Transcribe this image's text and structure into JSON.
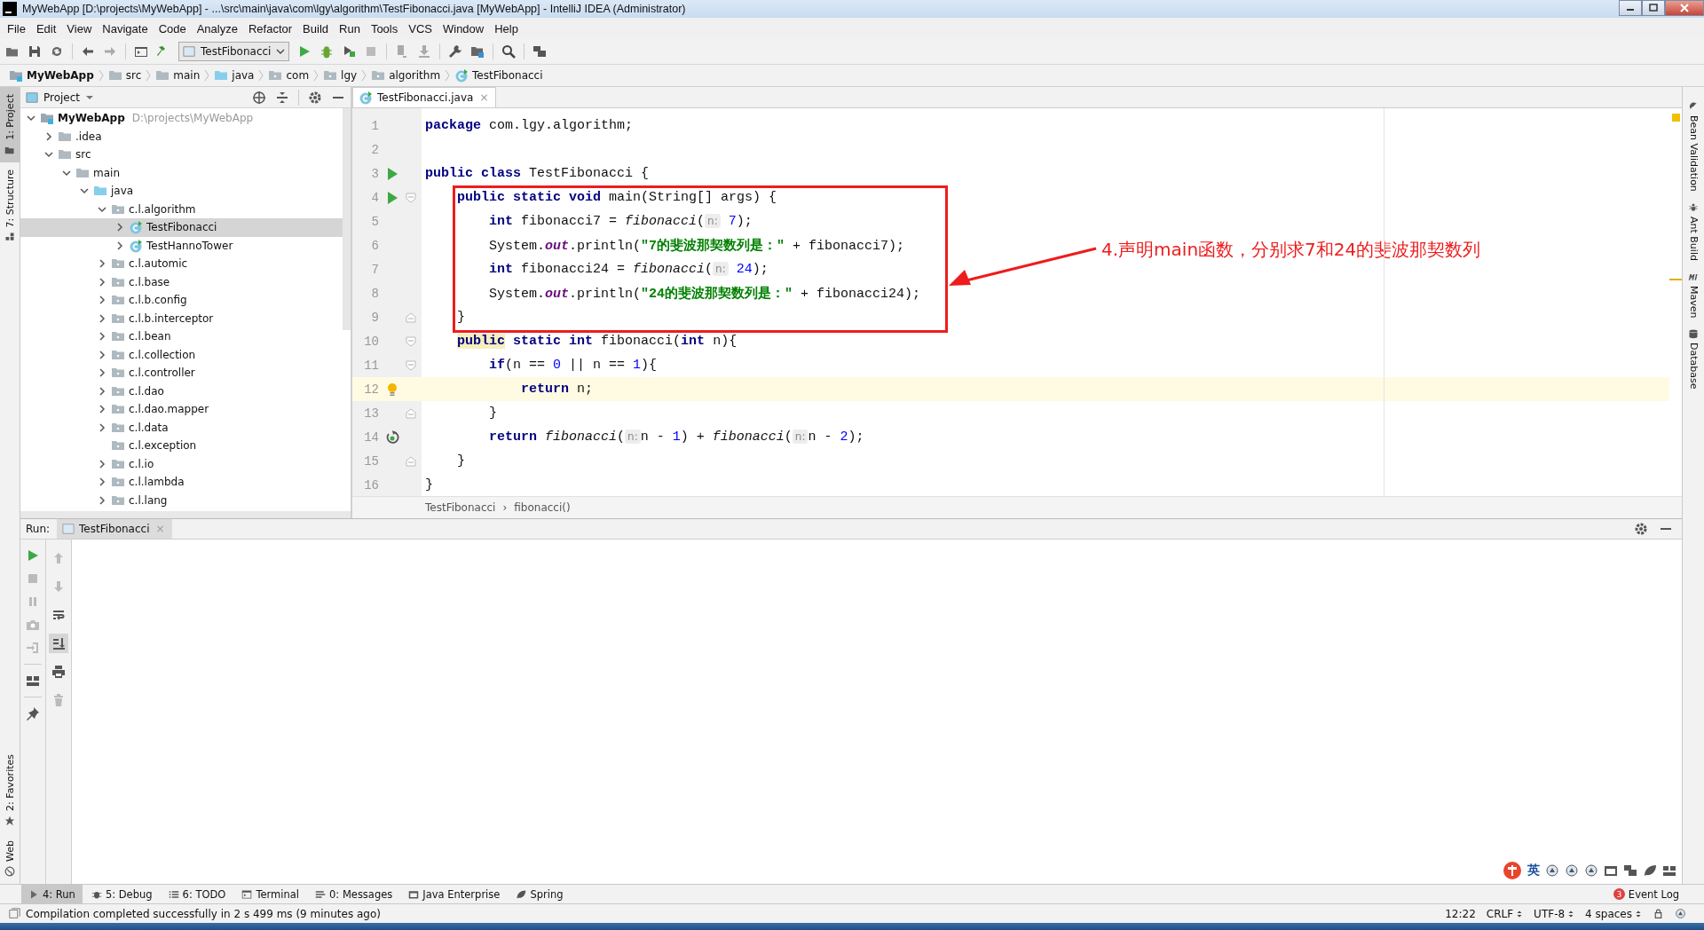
{
  "window": {
    "title": "MyWebApp [D:\\projects\\MyWebApp] - ...\\src\\main\\java\\com\\lgy\\algorithm\\TestFibonacci.java [MyWebApp] - IntelliJ IDEA (Administrator)"
  },
  "menu": [
    "File",
    "Edit",
    "View",
    "Navigate",
    "Code",
    "Analyze",
    "Refactor",
    "Build",
    "Run",
    "Tools",
    "VCS",
    "Window",
    "Help"
  ],
  "run_configuration": "TestFibonacci",
  "breadcrumbs": [
    {
      "label": "MyWebApp",
      "kind": "module"
    },
    {
      "label": "src",
      "kind": "folder"
    },
    {
      "label": "main",
      "kind": "folder"
    },
    {
      "label": "java",
      "kind": "source"
    },
    {
      "label": "com",
      "kind": "package"
    },
    {
      "label": "lgy",
      "kind": "package"
    },
    {
      "label": "algorithm",
      "kind": "package"
    },
    {
      "label": "TestFibonacci",
      "kind": "class"
    }
  ],
  "left_stripe": {
    "top": [
      {
        "label": "1: Project",
        "selected": true
      },
      {
        "label": "7: Structure",
        "selected": false
      }
    ],
    "bottom": [
      {
        "label": "2: Favorites",
        "selected": false
      },
      {
        "label": "Web",
        "selected": false
      }
    ]
  },
  "right_stripe": [
    "Bean Validation",
    "Ant Build",
    "Maven",
    "Database"
  ],
  "project_panel": {
    "title": "Project",
    "tree": [
      {
        "label": "MyWebApp",
        "path": "D:\\projects\\MyWebApp",
        "kind": "module",
        "expandable": true,
        "expanded": true,
        "selected": false,
        "children": [
          {
            "label": ".idea",
            "kind": "folder",
            "expandable": true,
            "expanded": false,
            "selected": false
          },
          {
            "label": "src",
            "kind": "folder",
            "expandable": true,
            "expanded": true,
            "selected": false,
            "children": [
              {
                "label": "main",
                "kind": "folder",
                "expandable": true,
                "expanded": true,
                "selected": false,
                "children": [
                  {
                    "label": "java",
                    "kind": "source",
                    "expandable": true,
                    "expanded": true,
                    "selected": false,
                    "children": [
                      {
                        "label": "c.l.algorithm",
                        "kind": "package",
                        "expandable": true,
                        "expanded": true,
                        "selected": false,
                        "children": [
                          {
                            "label": "TestFibonacci",
                            "kind": "class",
                            "expandable": true,
                            "expanded": false,
                            "selected": true
                          },
                          {
                            "label": "TestHannoTower",
                            "kind": "class",
                            "expandable": true,
                            "expanded": false,
                            "selected": false
                          }
                        ]
                      },
                      {
                        "label": "c.l.automic",
                        "kind": "package",
                        "expandable": true,
                        "expanded": false,
                        "selected": false
                      },
                      {
                        "label": "c.l.base",
                        "kind": "package",
                        "expandable": true,
                        "expanded": false,
                        "selected": false
                      },
                      {
                        "label": "c.l.b.config",
                        "kind": "package",
                        "expandable": true,
                        "expanded": false,
                        "selected": false
                      },
                      {
                        "label": "c.l.b.interceptor",
                        "kind": "package",
                        "expandable": true,
                        "expanded": false,
                        "selected": false
                      },
                      {
                        "label": "c.l.bean",
                        "kind": "package",
                        "expandable": true,
                        "expanded": false,
                        "selected": false
                      },
                      {
                        "label": "c.l.collection",
                        "kind": "package",
                        "expandable": true,
                        "expanded": false,
                        "selected": false
                      },
                      {
                        "label": "c.l.controller",
                        "kind": "package",
                        "expandable": true,
                        "expanded": false,
                        "selected": false
                      },
                      {
                        "label": "c.l.dao",
                        "kind": "package",
                        "expandable": true,
                        "expanded": false,
                        "selected": false
                      },
                      {
                        "label": "c.l.dao.mapper",
                        "kind": "package",
                        "expandable": true,
                        "expanded": false,
                        "selected": false
                      },
                      {
                        "label": "c.l.data",
                        "kind": "package",
                        "expandable": true,
                        "expanded": false,
                        "selected": false
                      },
                      {
                        "label": "c.l.exception",
                        "kind": "package",
                        "expandable": false,
                        "expanded": false,
                        "selected": false
                      },
                      {
                        "label": "c.l.io",
                        "kind": "package",
                        "expandable": true,
                        "expanded": false,
                        "selected": false
                      },
                      {
                        "label": "c.l.lambda",
                        "kind": "package",
                        "expandable": true,
                        "expanded": false,
                        "selected": false
                      },
                      {
                        "label": "c.l.lang",
                        "kind": "package",
                        "expandable": true,
                        "expanded": false,
                        "selected": false
                      }
                    ]
                  }
                ]
              }
            ]
          }
        ]
      }
    ]
  },
  "editor": {
    "tab": {
      "label": "TestFibonacci.java",
      "close": "×"
    },
    "lines": [
      {
        "number": "1",
        "run": false,
        "fold_start": false,
        "fold_end": false,
        "intention": false,
        "recursive_call": false,
        "current": false,
        "tokens": [
          {
            "kind": "keyword",
            "text": "package"
          },
          {
            "kind": "plain",
            "text": " com.lgy.algorithm;"
          }
        ]
      },
      {
        "number": "2",
        "run": false,
        "fold_start": false,
        "fold_end": false,
        "intention": false,
        "recursive_call": false,
        "current": false
      },
      {
        "number": "3",
        "run": true,
        "fold_start": false,
        "fold_end": false,
        "intention": false,
        "recursive_call": false,
        "current": false,
        "tokens": [
          {
            "kind": "keyword",
            "text": "public class"
          },
          {
            "kind": "plain",
            "text": " TestFibonacci {"
          }
        ]
      },
      {
        "number": "4",
        "run": true,
        "fold_start": true,
        "fold_end": false,
        "intention": false,
        "recursive_call": false,
        "current": false,
        "tokens": [
          {
            "kind": "keyword",
            "text": "    public static void"
          },
          {
            "kind": "plain",
            "text": " main(String[] args) {"
          }
        ]
      },
      {
        "number": "5",
        "run": false,
        "fold_start": false,
        "fold_end": false,
        "intention": false,
        "recursive_call": false,
        "current": false,
        "tokens": [
          {
            "kind": "keyword",
            "text": "        int"
          },
          {
            "kind": "plain",
            "text": " fibonacci7 = "
          },
          {
            "kind": "method",
            "text": "fibonacci"
          },
          {
            "kind": "plain",
            "text": "("
          },
          {
            "kind": "hint",
            "text": "n:"
          },
          {
            "kind": "number",
            "text": " 7"
          },
          {
            "kind": "plain",
            "text": ");"
          }
        ]
      },
      {
        "number": "6",
        "run": false,
        "fold_start": false,
        "fold_end": false,
        "intention": false,
        "recursive_call": false,
        "current": false,
        "tokens": [
          {
            "kind": "plain",
            "text": "        System."
          },
          {
            "kind": "field",
            "text": "out"
          },
          {
            "kind": "plain",
            "text": ".println("
          },
          {
            "kind": "string",
            "text": "\"7的斐波那契数列是：\""
          },
          {
            "kind": "plain",
            "text": " + fibonacci7);"
          }
        ]
      },
      {
        "number": "7",
        "run": false,
        "fold_start": false,
        "fold_end": false,
        "intention": false,
        "recursive_call": false,
        "current": false,
        "tokens": [
          {
            "kind": "keyword",
            "text": "        int"
          },
          {
            "kind": "plain",
            "text": " fibonacci24 = "
          },
          {
            "kind": "method",
            "text": "fibonacci"
          },
          {
            "kind": "plain",
            "text": "("
          },
          {
            "kind": "hint",
            "text": "n:"
          },
          {
            "kind": "number",
            "text": " 24"
          },
          {
            "kind": "plain",
            "text": ");"
          }
        ]
      },
      {
        "number": "8",
        "run": false,
        "fold_start": false,
        "fold_end": false,
        "intention": false,
        "recursive_call": false,
        "current": false,
        "tokens": [
          {
            "kind": "plain",
            "text": "        System."
          },
          {
            "kind": "field",
            "text": "out"
          },
          {
            "kind": "plain",
            "text": ".println("
          },
          {
            "kind": "string",
            "text": "\"24的斐波那契数列是：\""
          },
          {
            "kind": "plain",
            "text": " + fibonacci24);"
          }
        ]
      },
      {
        "number": "9",
        "run": false,
        "fold_start": false,
        "fold_end": true,
        "intention": false,
        "recursive_call": false,
        "current": false,
        "tokens": [
          {
            "kind": "plain",
            "text": "    }"
          }
        ]
      },
      {
        "number": "10",
        "run": false,
        "fold_start": true,
        "fold_end": false,
        "intention": false,
        "recursive_call": false,
        "current": false,
        "tokens": [
          {
            "kind": "keyword-marked",
            "text": "    public"
          },
          {
            "kind": "keyword",
            "text": " static int"
          },
          {
            "kind": "plain",
            "text": " fibonacci("
          },
          {
            "kind": "keyword",
            "text": "int"
          },
          {
            "kind": "plain",
            "text": " n){"
          }
        ]
      },
      {
        "number": "11",
        "run": false,
        "fold_start": true,
        "fold_end": false,
        "intention": false,
        "recursive_call": false,
        "current": false,
        "tokens": [
          {
            "kind": "keyword",
            "text": "        if"
          },
          {
            "kind": "plain",
            "text": "(n == "
          },
          {
            "kind": "number",
            "text": "0"
          },
          {
            "kind": "plain",
            "text": " || n == "
          },
          {
            "kind": "number",
            "text": "1"
          },
          {
            "kind": "plain",
            "text": "){"
          }
        ]
      },
      {
        "number": "12",
        "run": false,
        "fold_start": false,
        "fold_end": false,
        "intention": true,
        "recursive_call": false,
        "current": true,
        "tokens": [
          {
            "kind": "keyword",
            "text": "            return"
          },
          {
            "kind": "plain",
            "text": " n;"
          }
        ]
      },
      {
        "number": "13",
        "run": false,
        "fold_start": false,
        "fold_end": true,
        "intention": false,
        "recursive_call": false,
        "current": false,
        "tokens": [
          {
            "kind": "plain",
            "text": "        }"
          }
        ]
      },
      {
        "number": "14",
        "run": false,
        "fold_start": false,
        "fold_end": false,
        "intention": false,
        "recursive_call": true,
        "current": false,
        "tokens": [
          {
            "kind": "keyword",
            "text": "        return "
          },
          {
            "kind": "method",
            "text": "fibonacci"
          },
          {
            "kind": "plain",
            "text": "("
          },
          {
            "kind": "hint",
            "text": "n:"
          },
          {
            "kind": "plain",
            "text": "n - "
          },
          {
            "kind": "number",
            "text": "1"
          },
          {
            "kind": "plain",
            "text": ") + "
          },
          {
            "kind": "method",
            "text": "fibonacci"
          },
          {
            "kind": "plain",
            "text": "("
          },
          {
            "kind": "hint",
            "text": "n:"
          },
          {
            "kind": "plain",
            "text": "n - "
          },
          {
            "kind": "number",
            "text": "2"
          },
          {
            "kind": "plain",
            "text": ");"
          }
        ]
      },
      {
        "number": "15",
        "run": false,
        "fold_start": false,
        "fold_end": true,
        "intention": false,
        "recursive_call": false,
        "current": false,
        "tokens": [
          {
            "kind": "plain",
            "text": "    }"
          }
        ]
      },
      {
        "number": "16",
        "run": false,
        "fold_start": false,
        "fold_end": false,
        "intention": false,
        "recursive_call": false,
        "current": false,
        "tokens": [
          {
            "kind": "plain",
            "text": "}"
          }
        ]
      }
    ],
    "breadcrumbs": [
      "TestFibonacci",
      "›",
      "fibonacci()"
    ]
  },
  "annotation": {
    "text": "4.声明main函数，分别求7和24的斐波那契数列"
  },
  "run_panel": {
    "label": "Run:",
    "tab": {
      "label": "TestFibonacci",
      "close": "×"
    }
  },
  "ime_bar": {
    "label": "英"
  },
  "tool_tabs": [
    {
      "label": "4: Run",
      "kind": "run",
      "selected": true
    },
    {
      "label": "5: Debug",
      "kind": "debug",
      "selected": false
    },
    {
      "label": "6: TODO",
      "kind": "todo",
      "selected": false
    },
    {
      "label": "Terminal",
      "kind": "terminal",
      "selected": false
    },
    {
      "label": "0: Messages",
      "kind": "messages",
      "selected": false
    },
    {
      "label": "Java Enterprise",
      "kind": "enterprise",
      "selected": false
    },
    {
      "label": "Spring",
      "kind": "spring",
      "selected": false
    }
  ],
  "event_log": {
    "label": "Event Log",
    "count": "3"
  },
  "status_bar": {
    "message": "Compilation completed successfully in 2 s 499 ms (9 minutes ago)",
    "position": "12:22",
    "line_separator": "CRLF",
    "encoding": "UTF-8",
    "indent": "4 spaces"
  }
}
